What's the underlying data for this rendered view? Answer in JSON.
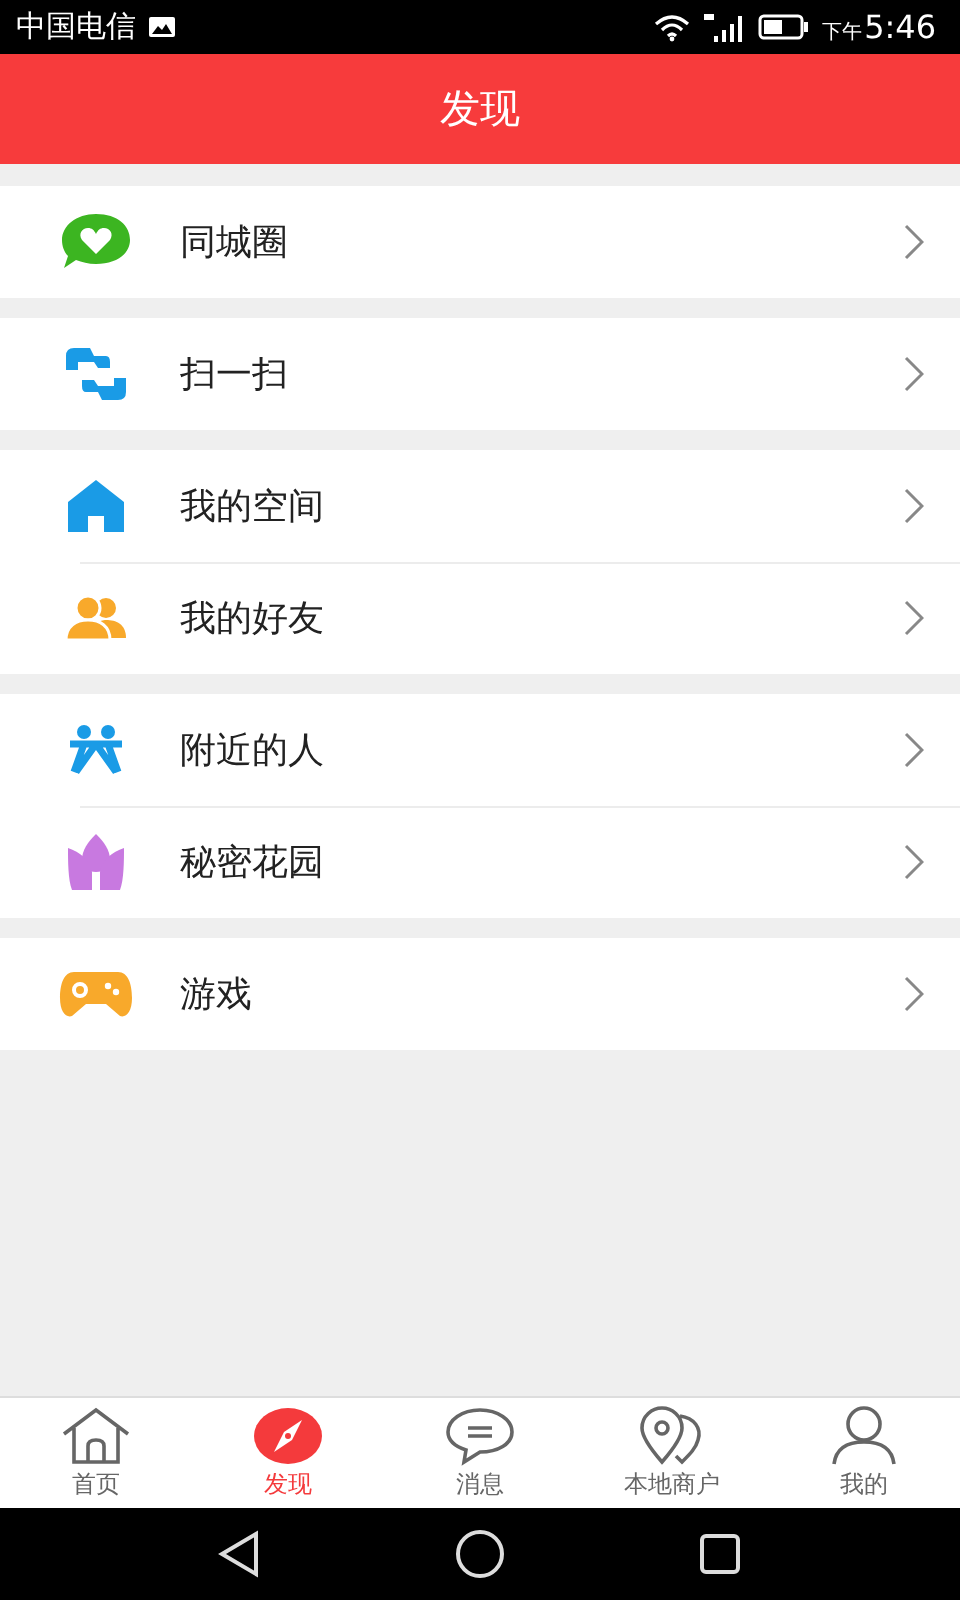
{
  "status_bar": {
    "carrier": "中国电信",
    "period": "下午",
    "time": "5:46"
  },
  "header": {
    "title": "发现"
  },
  "groups": [
    {
      "items": [
        {
          "kind": "moments",
          "label": "同城圈"
        }
      ]
    },
    {
      "items": [
        {
          "kind": "scan",
          "label": "扫一扫"
        }
      ]
    },
    {
      "items": [
        {
          "kind": "home",
          "label": "我的空间"
        },
        {
          "kind": "friends",
          "label": "我的好友"
        }
      ]
    },
    {
      "items": [
        {
          "kind": "nearby",
          "label": "附近的人"
        },
        {
          "kind": "garden",
          "label": "秘密花园"
        }
      ]
    },
    {
      "items": [
        {
          "kind": "game",
          "label": "游戏"
        }
      ]
    }
  ],
  "tabs": [
    {
      "kind": "home",
      "label": "首页",
      "selected": false
    },
    {
      "kind": "discover",
      "label": "发现",
      "selected": true
    },
    {
      "kind": "message",
      "label": "消息",
      "selected": false
    },
    {
      "kind": "shops",
      "label": "本地商户",
      "selected": false
    },
    {
      "kind": "me",
      "label": "我的",
      "selected": false
    }
  ]
}
